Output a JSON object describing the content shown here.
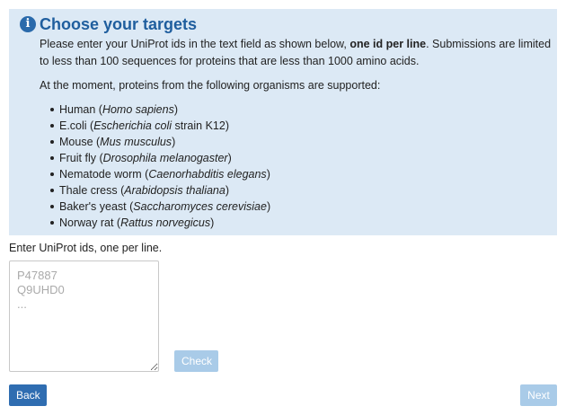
{
  "info": {
    "icon": "info-icon",
    "icon_glyph": "i",
    "title": "Choose your targets",
    "intro_before": "Please enter your UniProt ids in the text field as shown below, ",
    "intro_bold": "one id per line",
    "intro_after": ". Submissions are limited to less than 100 sequences for proteins that are less than 1000 amino acids.",
    "organisms_intro": "At the moment, proteins from the following organisms are supported:",
    "organisms": [
      {
        "common": "Human",
        "scientific": "Homo sapiens",
        "suffix": ""
      },
      {
        "common": "E.coli",
        "scientific": "Escherichia coli",
        "suffix": " strain K12"
      },
      {
        "common": "Mouse",
        "scientific": "Mus musculus",
        "suffix": ""
      },
      {
        "common": "Fruit fly",
        "scientific": "Drosophila melanogaster",
        "suffix": ""
      },
      {
        "common": "Nematode worm",
        "scientific": "Caenorhabditis elegans",
        "suffix": ""
      },
      {
        "common": "Thale cress",
        "scientific": "Arabidopsis thaliana",
        "suffix": ""
      },
      {
        "common": "Baker's yeast",
        "scientific": "Saccharomyces cerevisiae",
        "suffix": ""
      },
      {
        "common": "Norway rat",
        "scientific": "Rattus norvegicus",
        "suffix": ""
      }
    ],
    "box_color": "#dce9f5",
    "title_color": "#1f5e9e"
  },
  "form": {
    "input_label": "Enter UniProt ids, one per line.",
    "textarea_value": "",
    "textarea_placeholder": "P47887\nQ9UHD0\n...",
    "check_label": "Check"
  },
  "nav": {
    "back_label": "Back",
    "next_label": "Next",
    "primary_color": "#2f6db1",
    "disabled_color": "#a9cbe8"
  }
}
